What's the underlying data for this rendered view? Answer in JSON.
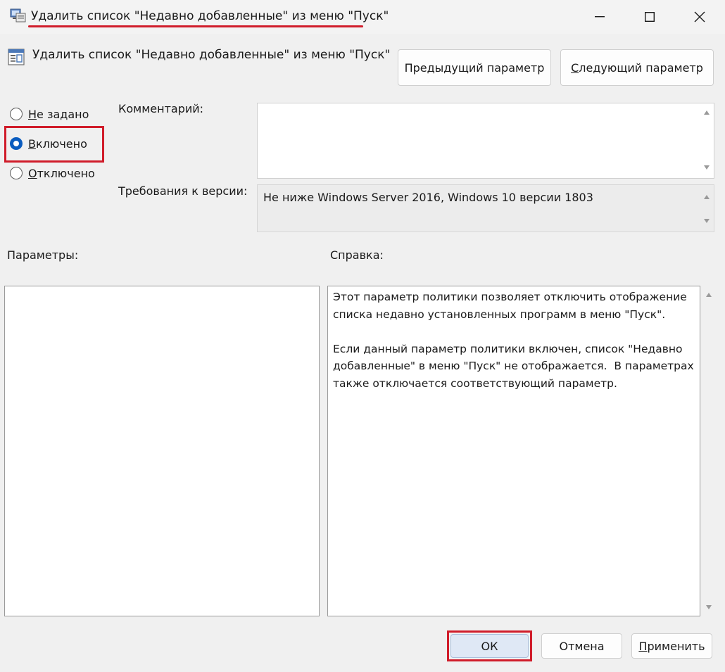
{
  "window": {
    "title": "Удалить список \"Недавно добавленные\" из меню \"Пуск\"",
    "minimize_icon": "minimize-icon",
    "maximize_icon": "maximize-icon",
    "close_icon": "close-icon"
  },
  "policy": {
    "name": "Удалить список \"Недавно добавленные\" из меню \"Пуск\"",
    "prev_button": {
      "before": "Пре",
      "mnemonic": "д",
      "after": "ыдущий параметр"
    },
    "next_button": {
      "before": "",
      "mnemonic": "С",
      "after": "ледующий параметр"
    }
  },
  "state": {
    "options": [
      {
        "before": "",
        "mnemonic": "Н",
        "after": "е задано",
        "checked": false
      },
      {
        "before": "",
        "mnemonic": "В",
        "after": "ключено",
        "checked": true
      },
      {
        "before": "",
        "mnemonic": "О",
        "after": "тключено",
        "checked": false
      }
    ]
  },
  "comment": {
    "label": "Комментарий:",
    "value": ""
  },
  "requirements": {
    "label": "Требования к версии:",
    "value": "Не ниже Windows Server 2016, Windows 10 версии 1803"
  },
  "parameters": {
    "label": "Параметры:"
  },
  "help": {
    "label": "Справка:",
    "text": "Этот параметр политики позволяет отключить отображение\nсписка недавно установленных программ в меню \"Пуск\".\n\nЕсли данный параметр политики включен, список \"Недавно\nдобавленные\" в меню \"Пуск\" не отображается.  В параметрах\nтакже отключается соответствующий параметр."
  },
  "footer": {
    "ok": "ОК",
    "cancel": "Отмена",
    "apply": {
      "before": "",
      "mnemonic": "П",
      "after": "рименить"
    }
  },
  "colors": {
    "accent": "#0a5cbf",
    "highlight": "#d01c2a"
  }
}
